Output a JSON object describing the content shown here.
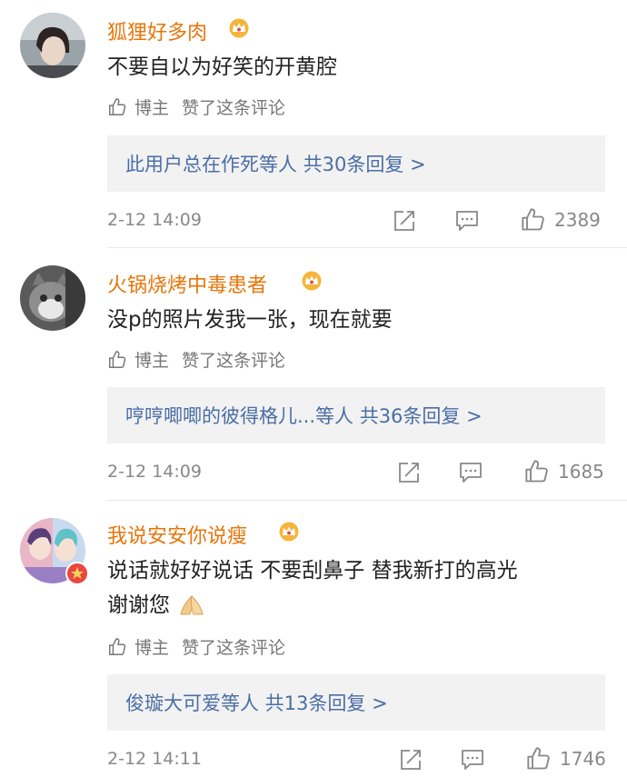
{
  "comments": [
    {
      "username": "狐狸好多肉",
      "text": "不要自以为好笑的开黄腔",
      "author_label": "博主",
      "liked_label": "赞了这条评论",
      "reply_summary": "此用户总在作死等人  共30条回复 >",
      "time": "2-12 14:09",
      "likes": "2389"
    },
    {
      "username": "火锅烧烤中毒患者",
      "text": "没p的照片发我一张，现在就要",
      "author_label": "博主",
      "liked_label": "赞了这条评论",
      "reply_summary": "哼哼唧唧的彼得格儿...等人  共36条回复 >",
      "time": "2-12 14:09",
      "likes": "1685"
    },
    {
      "username": "我说安安你说瘦",
      "text": "说话就好好说话 不要刮鼻子 替我新打的高光",
      "text2": "谢谢您",
      "author_label": "博主",
      "liked_label": "赞了这条评论",
      "reply_summary": "俊璇大可爱等人  共13条回复 >",
      "time": "2-12 14:11",
      "likes": "1746"
    }
  ],
  "colors": {
    "username": "#e8750a",
    "reply_link": "#4a6ea5",
    "meta": "#888888"
  }
}
